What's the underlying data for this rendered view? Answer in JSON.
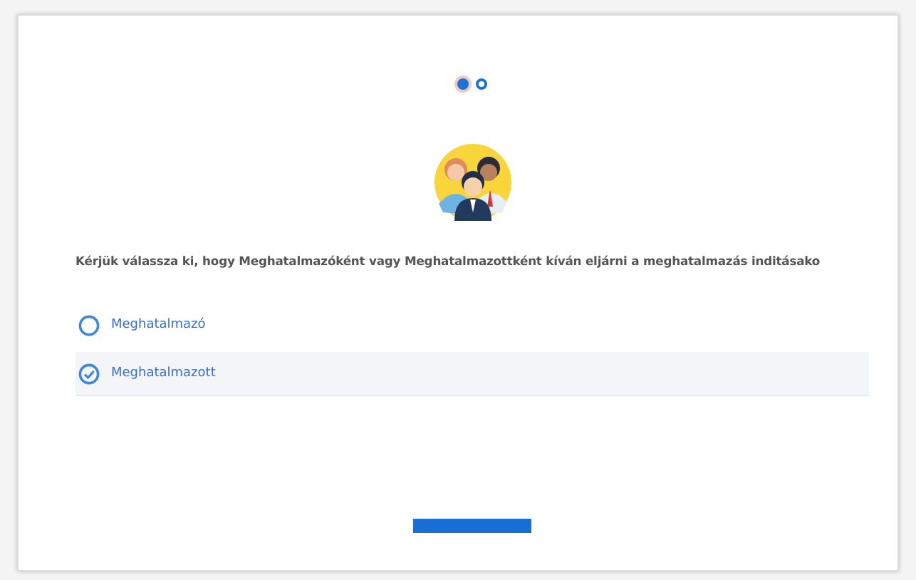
{
  "steps": [
    {
      "selected": true
    },
    {
      "selected": false
    }
  ],
  "prompt": "Kérjük válassza ki, hogy Meghatalmazóként vagy Meghatalmazottként kíván eljárni a meghatalmazás inditásako",
  "options": [
    {
      "label": "Meghatalmazó",
      "selected": false
    },
    {
      "label": "Meghatalmazott",
      "selected": true
    }
  ]
}
